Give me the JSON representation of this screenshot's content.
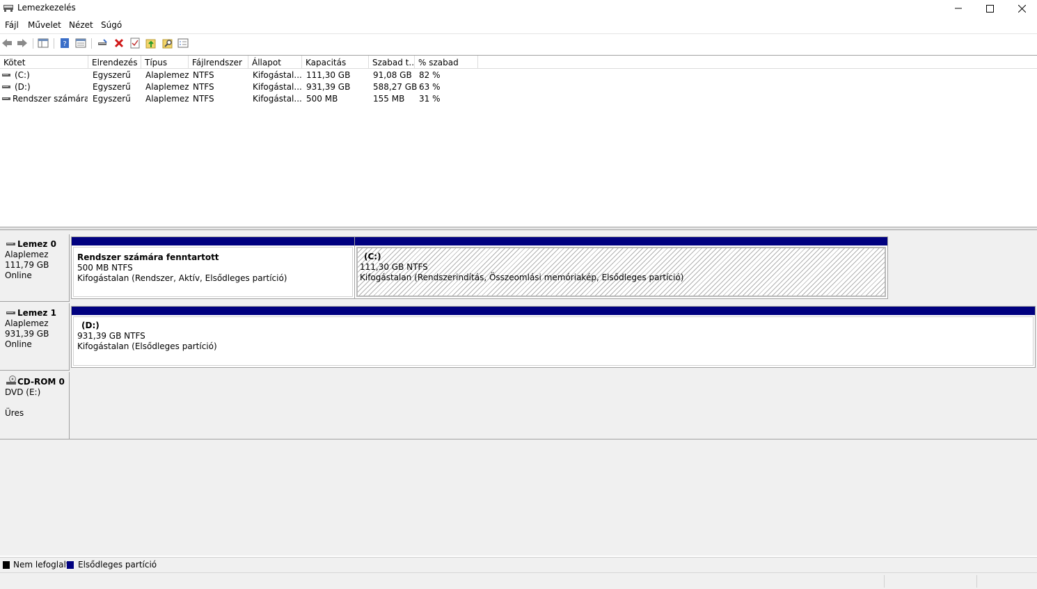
{
  "window": {
    "title": "Lemezkezelés"
  },
  "menu": [
    "Fájl",
    "Művelet",
    "Nézet",
    "Súgó"
  ],
  "toolbar": {
    "icons": [
      "back-icon",
      "forward-icon",
      "console-tree-icon",
      "help-icon",
      "properties-list-icon",
      "connect-icon",
      "delete-icon",
      "check-icon",
      "import-icon",
      "find-icon",
      "details-icon"
    ]
  },
  "volume_list": {
    "columns": [
      "Kötet",
      "Elrendezés",
      "Típus",
      "Fájlrendszer",
      "Állapot",
      "Kapacitás",
      "Szabad t...",
      "% szabad"
    ],
    "rows": [
      {
        "volume": "(C:)",
        "layout": "Egyszerű",
        "type": "Alaplemez",
        "fs": "NTFS",
        "status": "Kifogástal...",
        "capacity": "111,30 GB",
        "free": "91,08 GB",
        "pct": "82 %"
      },
      {
        "volume": "(D:)",
        "layout": "Egyszerű",
        "type": "Alaplemez",
        "fs": "NTFS",
        "status": "Kifogástal...",
        "capacity": "931,39 GB",
        "free": "588,27 GB",
        "pct": "63 %"
      },
      {
        "volume": "Rendszer számára ...",
        "layout": "Egyszerű",
        "type": "Alaplemez",
        "fs": "NTFS",
        "status": "Kifogástal...",
        "capacity": "500 MB",
        "free": "155 MB",
        "pct": "31 %"
      }
    ]
  },
  "disks": [
    {
      "name": "Lemez 0",
      "type": "Alaplemez",
      "size": "111,79 GB",
      "status": "Online",
      "partitions": [
        {
          "title": "Rendszer számára fenntartott",
          "size": "500 MB NTFS",
          "status": "Kifogástalan (Rendszer, Aktív, Elsődleges partíció)"
        },
        {
          "title": "(C:)",
          "size": "111,30 GB NTFS",
          "status": "Kifogástalan (Rendszerindítás, Összeomlási memóriakép, Elsődleges partíció)"
        }
      ]
    },
    {
      "name": "Lemez 1",
      "type": "Alaplemez",
      "size": "931,39 GB",
      "status": "Online",
      "partitions": [
        {
          "title": "(D:)",
          "size": "931,39 GB NTFS",
          "status": "Kifogástalan (Elsődleges partíció)"
        }
      ]
    },
    {
      "name": "CD-ROM 0",
      "type": "DVD (E:)",
      "status": "Üres"
    }
  ],
  "legend": [
    {
      "label": "Nem lefoglalt",
      "color": "#000000"
    },
    {
      "label": "Elsődleges partíció",
      "color": "#00007f"
    }
  ],
  "colors": {
    "partition_bar": "#00007f"
  }
}
